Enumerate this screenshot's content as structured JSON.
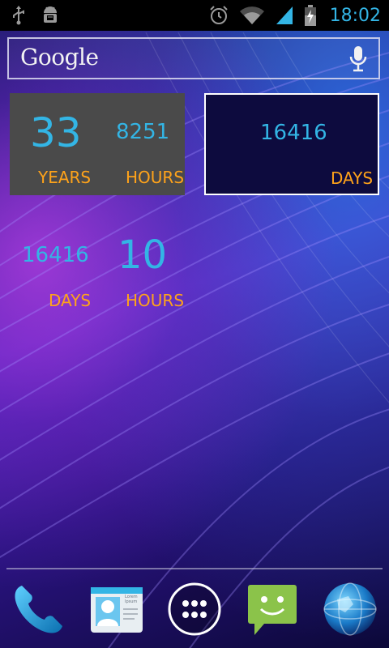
{
  "status_bar": {
    "time": "18:02",
    "icons": [
      "usb-icon",
      "android-debug-icon",
      "alarm-icon",
      "wifi-icon",
      "signal-icon",
      "battery-charging-icon"
    ]
  },
  "search": {
    "logo_text": "Google",
    "icon": "microphone-icon"
  },
  "widget_1": {
    "years_value": "33",
    "years_label": "YEARS",
    "hours_value": "8251",
    "hours_label": "HOURS"
  },
  "widget_2": {
    "days_value": "16416",
    "days_label": "DAYS"
  },
  "widget_3": {
    "days_value": "16416",
    "days_label": "DAYS",
    "hours_value": "10",
    "hours_label": "HOURS"
  },
  "dock": {
    "icons": [
      "phone-icon",
      "contacts-icon",
      "app-drawer-icon",
      "messaging-icon",
      "browser-icon"
    ],
    "contact_card_text": "Lorem Ipsum"
  },
  "colors": {
    "accent_blue": "#33b5e5",
    "label_orange": "#ffa31a"
  }
}
